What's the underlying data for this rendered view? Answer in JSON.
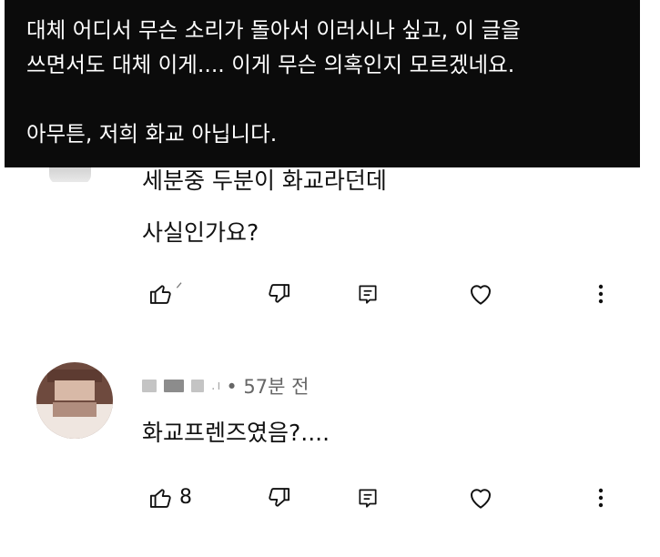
{
  "caption": {
    "lines": [
      "대체 어디서 무슨 소리가 돌아서 이러시나 싶고, 이 글을",
      "쓰면서도 대체 이게.... 이게 무슨 의혹인지 모르겠네요.",
      "",
      "아무튼, 저희 화교 아닙니다."
    ]
  },
  "comment1": {
    "lines": [
      "세분중 두분이 화교라던데",
      "사실인가요?"
    ],
    "like_count": "ᐟ"
  },
  "comment2": {
    "meta_separator": "•",
    "time": "57분 전",
    "text": "화교프렌즈였음?....",
    "like_count": "8"
  },
  "icons": {
    "like": "thumbs-up-icon",
    "dislike": "thumbs-down-icon",
    "reply": "reply-icon",
    "heart": "heart-icon",
    "more": "more-vertical-icon"
  },
  "colors": {
    "caption_bg": "#0b0b0b",
    "caption_text": "#ffffff",
    "text": "#111111",
    "meta": "#666666"
  }
}
